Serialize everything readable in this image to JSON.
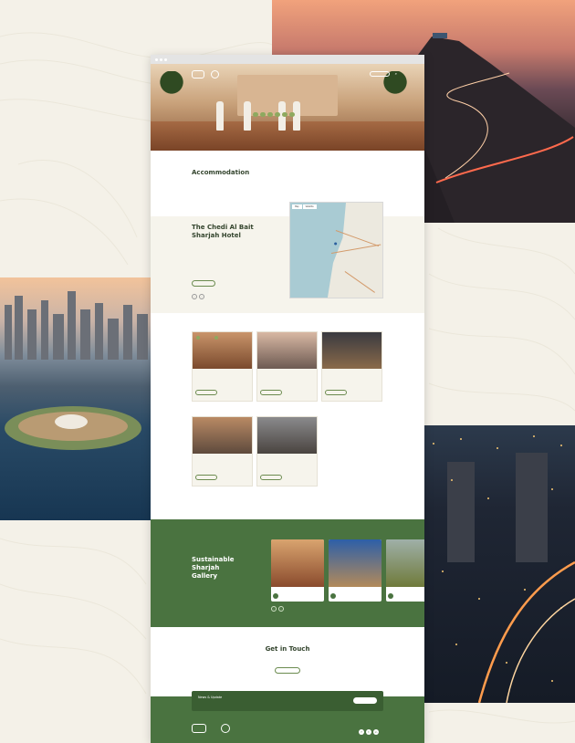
{
  "colors": {
    "brand_green": "#4a7340",
    "accent_green": "#8ea95f",
    "cream": "#f4f1e8",
    "cream_section": "#f6f4ec"
  },
  "backdrop": {
    "photos": [
      "mountain-road-at-dusk",
      "sharjah-city-waterfront-aerial",
      "city-night-aerial"
    ]
  },
  "site": {
    "hero": {
      "nav_items": [
        "",
        "",
        ""
      ],
      "nav_button": "",
      "tags": [
        "",
        "",
        "",
        "",
        "",
        ""
      ]
    },
    "accommodation": {
      "title": "Accommodation",
      "description": ""
    },
    "featured_hotel": {
      "title": "The Chedi Al Bait Sharjah Hotel",
      "description": "",
      "button": "",
      "map_tabs": [
        "Map",
        "Satellite"
      ]
    },
    "cards": [
      {
        "title": "",
        "text": "",
        "button": "",
        "chips": [
          "",
          ""
        ]
      },
      {
        "title": "",
        "text": "",
        "button": ""
      },
      {
        "title": "",
        "text": "",
        "button": ""
      },
      {
        "title": "",
        "text": "",
        "button": ""
      },
      {
        "title": "",
        "text": "",
        "button": ""
      }
    ],
    "gallery": {
      "title": "Sustainable Sharjah Gallery",
      "items": [
        {
          "title": "",
          "subtitle": ""
        },
        {
          "title": "",
          "subtitle": ""
        },
        {
          "title": "",
          "subtitle": ""
        }
      ]
    },
    "get_in_touch": {
      "title": "Get in Touch",
      "description": "",
      "button": ""
    },
    "newsletter": {
      "title": "News & Update",
      "subtitle": "",
      "button": ""
    },
    "footer": {
      "logo_texts": [
        "",
        ""
      ],
      "socials": [
        "f",
        "t",
        "in"
      ],
      "links": [
        "",
        "",
        ""
      ]
    }
  }
}
